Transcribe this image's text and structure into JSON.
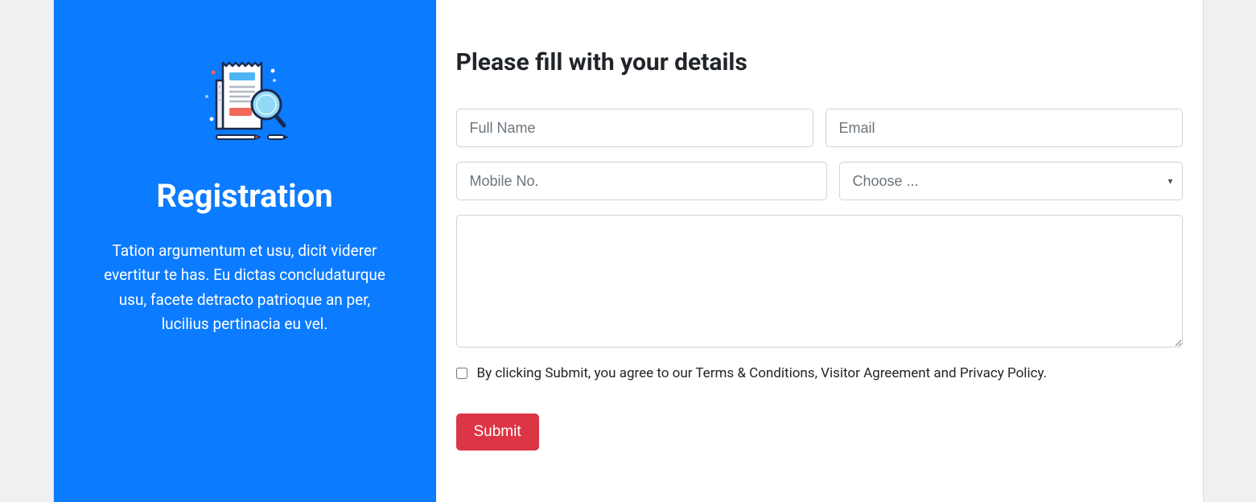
{
  "sidebar": {
    "title": "Registration",
    "description": "Tation argumentum et usu, dicit viderer evertitur te has. Eu dictas concludaturque usu, facete detracto patrioque an per, lucilius pertinacia eu vel."
  },
  "main": {
    "heading": "Please fill with your details",
    "form": {
      "full_name_placeholder": "Full Name",
      "email_placeholder": "Email",
      "mobile_placeholder": "Mobile No.",
      "select_default": "Choose ...",
      "checkbox_label": "By clicking Submit, you agree to our Terms & Conditions, Visitor Agreement and Privacy Policy.",
      "submit_label": "Submit"
    }
  }
}
